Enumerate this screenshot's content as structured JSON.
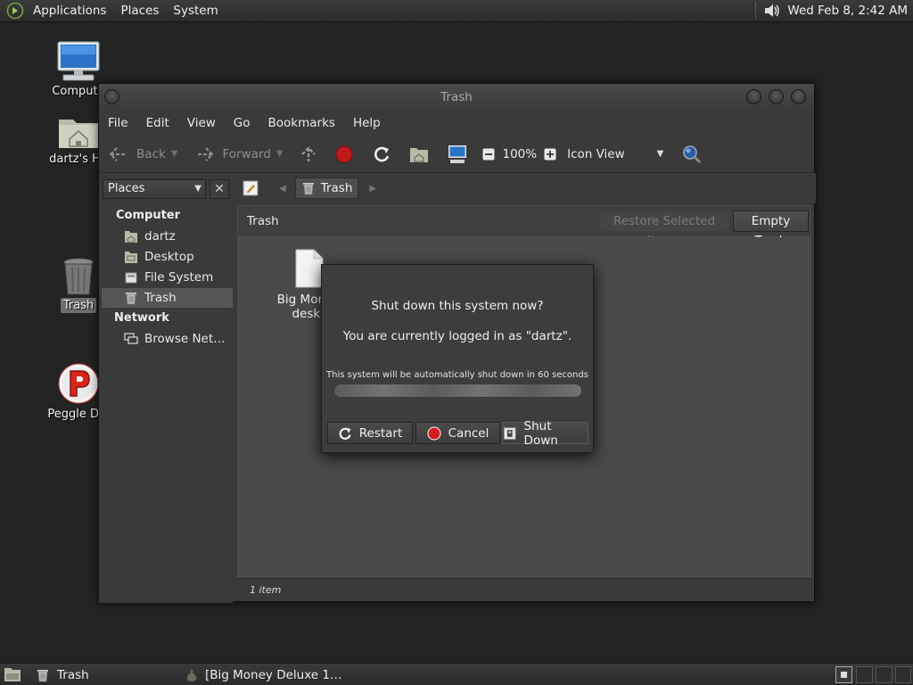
{
  "top_panel": {
    "menus": [
      "Applications",
      "Places",
      "System"
    ],
    "clock": "Wed Feb  8,  2:42 AM"
  },
  "desktop": {
    "icons": [
      {
        "label": "Compute"
      },
      {
        "label": "dartz's Ho"
      },
      {
        "label": "Trash"
      },
      {
        "label": "Peggle Del"
      }
    ]
  },
  "window": {
    "title": "Trash",
    "menubar": [
      "File",
      "Edit",
      "View",
      "Go",
      "Bookmarks",
      "Help"
    ],
    "toolbar": {
      "back": "Back",
      "forward": "Forward",
      "zoom": "100%",
      "view_mode": "Icon View"
    },
    "sidebar": {
      "selector": "Places",
      "close": "✕",
      "headings": [
        "Computer",
        "Network"
      ],
      "items": [
        {
          "label": "dartz"
        },
        {
          "label": "Desktop"
        },
        {
          "label": "File System"
        },
        {
          "label": "Trash"
        },
        {
          "label": "Browse Net…"
        }
      ]
    },
    "location": {
      "crumb": "Trash"
    },
    "content": {
      "header_title": "Trash",
      "restore_label": "Restore Selected Items",
      "empty_label": "Empty Trash",
      "file": {
        "line1": "Big Money",
        "line2": "deskt"
      }
    },
    "status": "1 item"
  },
  "dialog": {
    "question": "Shut down this system now?",
    "logged_in": "You are currently logged in as \"dartz\".",
    "auto_text": "This system will be automatically shut down in 60 seconds",
    "progress": 1.0,
    "buttons": {
      "restart": "Restart",
      "cancel": "Cancel",
      "shutdown": "Shut Down"
    }
  },
  "bottom_panel": {
    "tasks": [
      "Trash",
      "[Big Money Deluxe 1…"
    ]
  },
  "colors": {
    "desktop_bg": "#222322",
    "window_bg": "#3a3a3a",
    "content_bg": "#4a4a4a",
    "stop_red": "#c0191c"
  }
}
